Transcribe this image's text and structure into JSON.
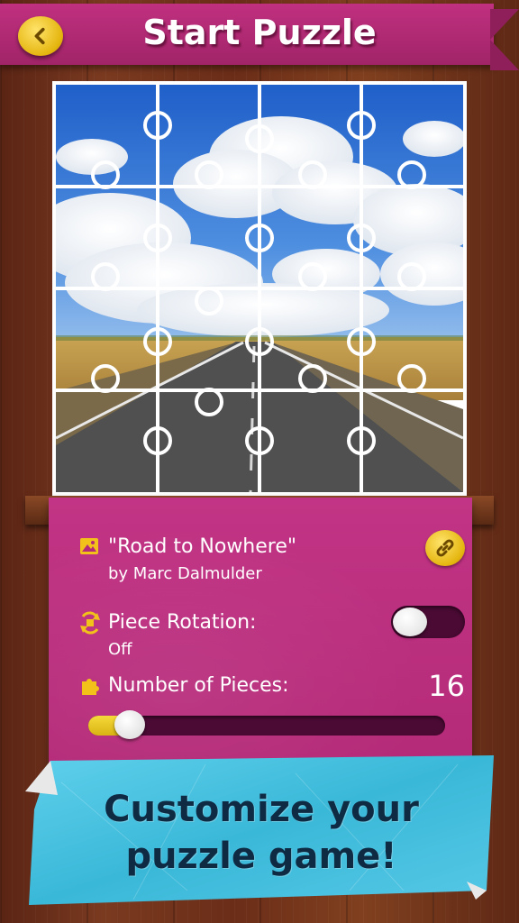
{
  "header": {
    "title": "Start Puzzle",
    "back_icon": "chevron-left-icon"
  },
  "puzzle": {
    "pieces_grid": "4x4"
  },
  "info": {
    "image_icon": "image-icon",
    "image_title": "\"Road to Nowhere\"",
    "image_author": "by Marc Dalmulder",
    "link_icon": "link-icon",
    "rotation_icon": "rotate-icon",
    "rotation_label": "Piece Rotation:",
    "rotation_value": "Off",
    "rotation_enabled": false,
    "pieces_icon": "puzzle-piece-icon",
    "pieces_label": "Number of Pieces:",
    "pieces_value": "16",
    "pieces_slider_fraction": 0.08
  },
  "banner": {
    "line1": "Customize your",
    "line2": "puzzle game!"
  },
  "colors": {
    "ribbon": "#b42a78",
    "panel": "#c23485",
    "accent_gold": "#e4b50e",
    "banner": "#3ab8d8"
  }
}
